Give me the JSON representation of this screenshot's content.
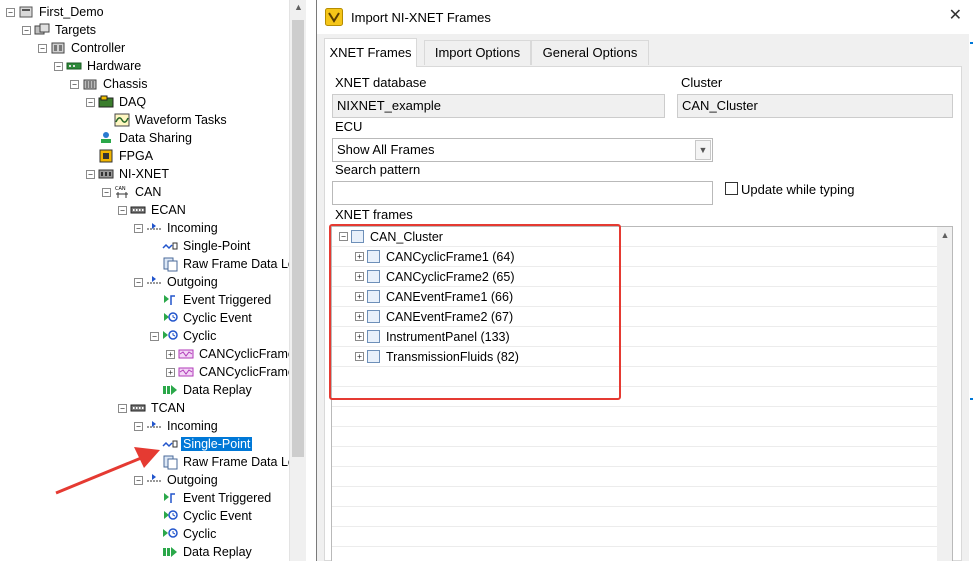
{
  "colors": {
    "selection": "#0078d7",
    "annotation_red": "#e53a32",
    "dialog_bg": "#f0f0f0"
  },
  "tree": {
    "items": [
      {
        "label": "First_Demo",
        "icon": "project-icon",
        "expander": "⊟"
      },
      {
        "label": "Targets",
        "icon": "targets-icon",
        "expander": "⊟"
      },
      {
        "label": "Controller",
        "icon": "controller-icon",
        "expander": "⊟"
      },
      {
        "label": "Hardware",
        "icon": "hardware-icon",
        "expander": "⊟"
      },
      {
        "label": "Chassis",
        "icon": "chassis-icon",
        "expander": "⊟"
      },
      {
        "label": "DAQ",
        "icon": "daq-icon",
        "expander": "⊟"
      },
      {
        "label": "Waveform Tasks",
        "icon": "waveform-icon",
        "expander": ""
      },
      {
        "label": "Data Sharing",
        "icon": "data-sharing-icon",
        "expander": ""
      },
      {
        "label": "FPGA",
        "icon": "fpga-icon",
        "expander": ""
      },
      {
        "label": "NI-XNET",
        "icon": "nixnet-icon",
        "expander": "⊟"
      },
      {
        "label": "CAN",
        "icon": "can-icon",
        "expander": "⊟"
      },
      {
        "label": "ECAN",
        "icon": "port-icon",
        "expander": "⊟"
      },
      {
        "label": "Incoming",
        "icon": "incoming-icon",
        "expander": "⊟"
      },
      {
        "label": "Single-Point",
        "icon": "single-point-icon",
        "expander": ""
      },
      {
        "label": "Raw Frame Data Lo",
        "icon": "raw-frame-icon",
        "expander": ""
      },
      {
        "label": "Outgoing",
        "icon": "outgoing-icon",
        "expander": "⊟"
      },
      {
        "label": "Event Triggered",
        "icon": "event-triggered-icon",
        "expander": ""
      },
      {
        "label": "Cyclic Event",
        "icon": "cyclic-event-icon",
        "expander": ""
      },
      {
        "label": "Cyclic",
        "icon": "cyclic-icon",
        "expander": "⊟"
      },
      {
        "label": "CANCyclicFrame",
        "icon": "frame-icon",
        "expander": "⊞"
      },
      {
        "label": "CANCyclicFrame",
        "icon": "frame-icon",
        "expander": "⊞"
      },
      {
        "label": "Data Replay",
        "icon": "data-replay-icon",
        "expander": ""
      },
      {
        "label": "TCAN",
        "icon": "port-icon",
        "expander": "⊟"
      },
      {
        "label": "Incoming",
        "icon": "incoming-icon",
        "expander": "⊟"
      },
      {
        "label": "Single-Point",
        "icon": "single-point-icon",
        "expander": "",
        "selected": true
      },
      {
        "label": "Raw Frame Data Lo",
        "icon": "raw-frame-icon",
        "expander": ""
      },
      {
        "label": "Outgoing",
        "icon": "outgoing-icon",
        "expander": "⊟"
      },
      {
        "label": "Event Triggered",
        "icon": "event-triggered-icon",
        "expander": ""
      },
      {
        "label": "Cyclic Event",
        "icon": "cyclic-event-icon",
        "expander": ""
      },
      {
        "label": "Cyclic",
        "icon": "cyclic-icon",
        "expander": ""
      },
      {
        "label": "Data Replay",
        "icon": "data-replay-icon",
        "expander": ""
      }
    ]
  },
  "dialog": {
    "title": "Import NI-XNET Frames",
    "close": "✕",
    "tabs": [
      {
        "label": "XNET Frames",
        "active": true
      },
      {
        "label": "Import Options",
        "active": false
      },
      {
        "label": "General Options",
        "active": false
      }
    ],
    "xnet_database_label": "XNET database",
    "xnet_database_value": "NIXNET_example",
    "cluster_label": "Cluster",
    "cluster_value": "CAN_Cluster",
    "ecu_label": "ECU",
    "ecu_value": "Show All Frames",
    "search_label": "Search pattern",
    "search_value": "",
    "update_checkbox_label": "Update while typing",
    "update_checked": false,
    "frames_label": "XNET frames",
    "frames_root": "CAN_Cluster",
    "frames": [
      "CANCyclicFrame1 (64)",
      "CANCyclicFrame2 (65)",
      "CANEventFrame1 (66)",
      "CANEventFrame2 (67)",
      "InstrumentPanel (133)",
      "TransmissionFluids (82)"
    ]
  }
}
